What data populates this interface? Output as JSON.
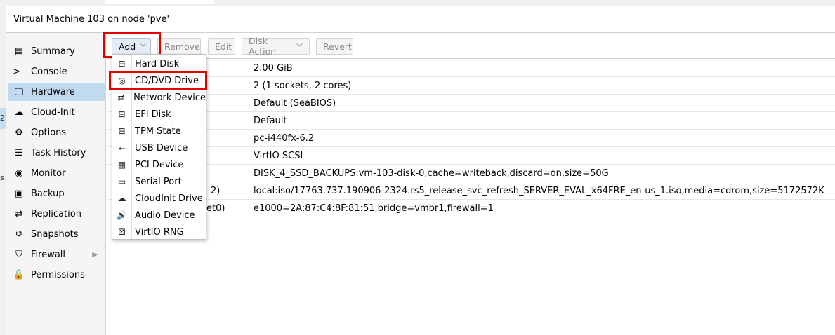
{
  "window_title": "Virtual Machine 103 on node 'pve'",
  "left_edge": {
    "text1": "2",
    "text2": "s"
  },
  "nav": [
    {
      "label": "Summary",
      "icon": "book-icon",
      "glyph": "▤"
    },
    {
      "label": "Console",
      "icon": "terminal-icon",
      "glyph": ">_"
    },
    {
      "label": "Hardware",
      "icon": "monitor-icon",
      "glyph": "🖵"
    },
    {
      "label": "Cloud-Init",
      "icon": "cloud-icon",
      "glyph": "☁"
    },
    {
      "label": "Options",
      "icon": "gear-icon",
      "glyph": "⚙"
    },
    {
      "label": "Task History",
      "icon": "list-icon",
      "glyph": "☰"
    },
    {
      "label": "Monitor",
      "icon": "eye-icon",
      "glyph": "◉"
    },
    {
      "label": "Backup",
      "icon": "floppy-icon",
      "glyph": "▣"
    },
    {
      "label": "Replication",
      "icon": "retweet-icon",
      "glyph": "⇄"
    },
    {
      "label": "Snapshots",
      "icon": "history-icon",
      "glyph": "↺"
    },
    {
      "label": "Firewall",
      "icon": "shield-icon",
      "glyph": "⛉"
    },
    {
      "label": "Permissions",
      "icon": "unlock-icon",
      "glyph": "🔓"
    }
  ],
  "toolbar": {
    "add": "Add",
    "remove": "Remove",
    "edit": "Edit",
    "disk_action": "Disk Action",
    "revert": "Revert"
  },
  "rows": [
    {
      "key": "",
      "value": "2.00 GiB"
    },
    {
      "key": "",
      "value": "2 (1 sockets, 2 cores)"
    },
    {
      "key": "",
      "value": "Default (SeaBIOS)"
    },
    {
      "key": "",
      "value": "Default"
    },
    {
      "key": "",
      "value": "pc-i440fx-6.2"
    },
    {
      "key": "",
      "value": "VirtIO SCSI"
    },
    {
      "key": "",
      "value": "DISK_4_SSD_BACKUPS:vm-103-disk-0,cache=writeback,discard=on,size=50G"
    },
    {
      "key": "2)",
      "value": "local:iso/17763.737.190906-2324.rs5_release_svc_refresh_SERVER_EVAL_x64FRE_en-us_1.iso,media=cdrom,size=5172572K"
    },
    {
      "key": "et0)",
      "value": "e1000=2A:87:C4:8F:81:51,bridge=vmbr1,firewall=1"
    }
  ],
  "add_menu": [
    {
      "label": "Hard Disk",
      "icon": "hdd-icon",
      "glyph": "⊟"
    },
    {
      "label": "CD/DVD Drive",
      "icon": "cdrom-icon",
      "glyph": "◎"
    },
    {
      "label": "Network Device",
      "icon": "exchange-icon",
      "glyph": "⇄"
    },
    {
      "label": "EFI Disk",
      "icon": "hdd-icon",
      "glyph": "⊟"
    },
    {
      "label": "TPM State",
      "icon": "hdd-icon",
      "glyph": "⊟"
    },
    {
      "label": "USB Device",
      "icon": "usb-icon",
      "glyph": "⭠"
    },
    {
      "label": "PCI Device",
      "icon": "pci-card-icon",
      "glyph": "▦"
    },
    {
      "label": "Serial Port",
      "icon": "serial-port-icon",
      "glyph": "▭"
    },
    {
      "label": "CloudInit Drive",
      "icon": "cloud-icon",
      "glyph": "☁"
    },
    {
      "label": "Audio Device",
      "icon": "volume-icon",
      "glyph": "🔊"
    },
    {
      "label": "VirtIO RNG",
      "icon": "dice-icon",
      "glyph": "⚄"
    }
  ],
  "colors": {
    "highlight": "#e00000",
    "nav_active": "#c2daf0",
    "button_active": "#e4edf7"
  }
}
